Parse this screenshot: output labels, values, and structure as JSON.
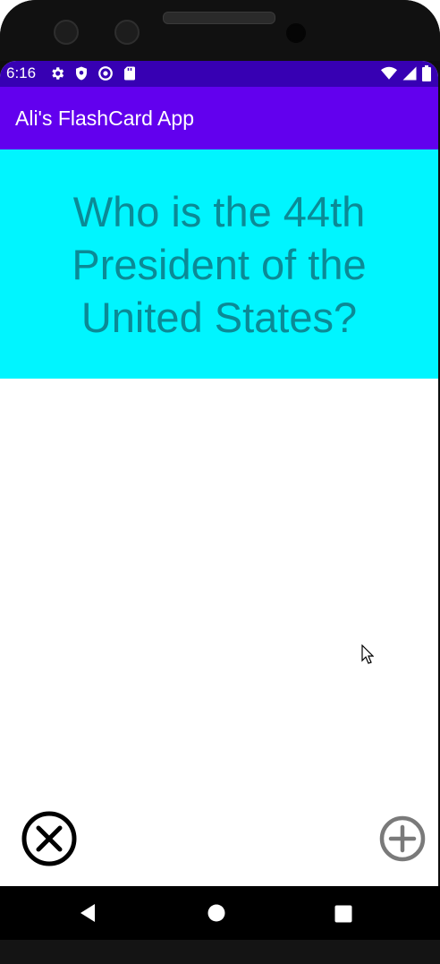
{
  "status_bar": {
    "time": "6:16",
    "icons_left": [
      "gear-icon",
      "shield-icon",
      "sync-icon",
      "sd-card-icon"
    ],
    "icons_right": [
      "wifi-icon",
      "signal-icon",
      "battery-icon"
    ]
  },
  "app_bar": {
    "title": "Ali's FlashCard App",
    "color": "#6200ee",
    "status_color": "#3700b3"
  },
  "flashcard": {
    "question": "Who is the 44th President of the United States?",
    "background": "#00f5ff",
    "text_color": "#0b8a96"
  },
  "actions": {
    "cancel_icon": "close-circle-icon",
    "add_icon": "add-circle-icon"
  },
  "nav": {
    "buttons": [
      "back-icon",
      "home-icon",
      "recent-apps-icon"
    ]
  }
}
